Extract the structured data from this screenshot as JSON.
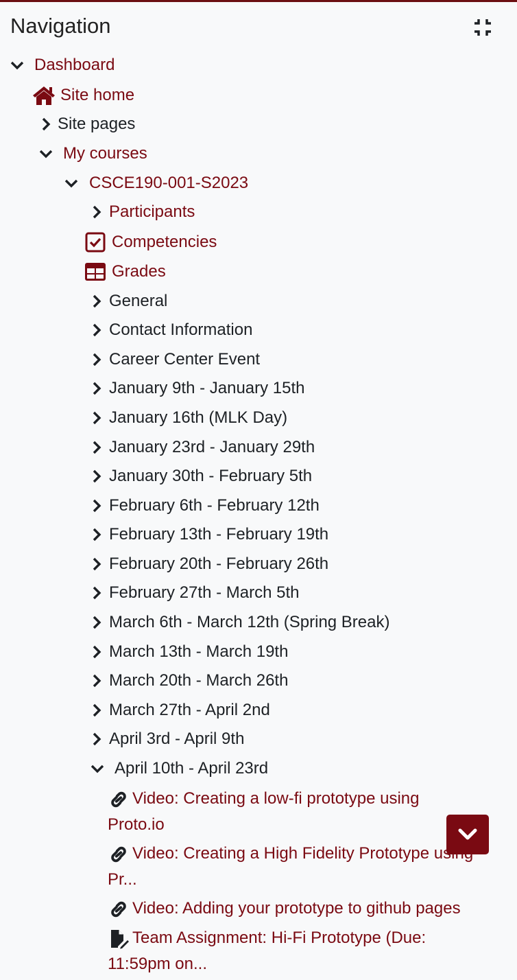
{
  "header": {
    "title": "Navigation"
  },
  "colors": {
    "accent": "#7a0a12",
    "text": "#1d2125",
    "background": "#f8f9fa"
  },
  "tree": {
    "dashboard": "Dashboard",
    "site_home": "Site home",
    "site_pages": "Site pages",
    "my_courses": "My courses",
    "course": "CSCE190-001-S2023",
    "participants": "Participants",
    "competencies": "Competencies",
    "grades": "Grades",
    "sections": [
      "General",
      "Contact Information",
      "Career Center Event",
      "January 9th - January 15th",
      "January 16th (MLK Day)",
      "January 23rd - January 29th",
      "January 30th - February 5th",
      "February 6th - February 12th",
      "February 13th - February 19th",
      "February 20th - February 26th",
      "February 27th - March 5th",
      "March 6th - March 12th (Spring Break)",
      "March 13th - March 19th",
      "March 20th - March 26th",
      "March 27th - April 2nd",
      "April 3rd - April 9th"
    ],
    "open_section": "April 10th - April 23rd",
    "activities": [
      {
        "label": "Video: Creating a low-fi prototype using Proto.io",
        "icon": "link-icon"
      },
      {
        "label": "Video: Creating a High Fidelity Prototype using Pr...",
        "icon": "link-icon"
      },
      {
        "label": "Video: Adding your prototype to github pages",
        "icon": "link-icon"
      },
      {
        "label": "Team Assignment: Hi-Fi Prototype (Due: 11:59pm on...",
        "icon": "assignment-icon"
      }
    ]
  }
}
